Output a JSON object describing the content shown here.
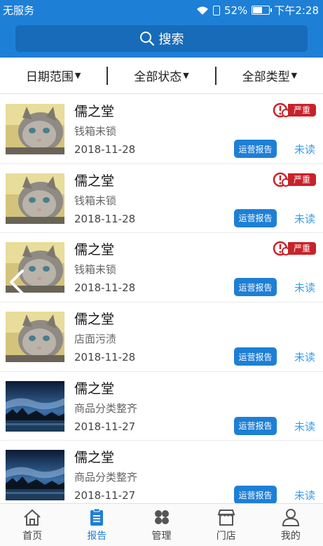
{
  "status_bar": {
    "carrier": "无服务",
    "battery": "52%",
    "time": "下午2:28"
  },
  "search": {
    "label": "搜索"
  },
  "filters": [
    {
      "label": "日期范围"
    },
    {
      "label": "全部状态"
    },
    {
      "label": "全部类型"
    }
  ],
  "list": {
    "items": [
      {
        "title": "儒之堂",
        "desc": "钱箱未锁",
        "date": "2018-11-28",
        "severity": "严重",
        "button": "运营报告",
        "status": "未读",
        "image": "cat"
      },
      {
        "title": "儒之堂",
        "desc": "钱箱未锁",
        "date": "2018-11-28",
        "severity": "严重",
        "button": "运营报告",
        "status": "未读",
        "image": "cat"
      },
      {
        "title": "儒之堂",
        "desc": "钱箱未锁",
        "date": "2018-11-28",
        "severity": "严重",
        "button": "运营报告",
        "status": "未读",
        "image": "cat"
      },
      {
        "title": "儒之堂",
        "desc": "店面污渍",
        "date": "2018-11-28",
        "severity": "",
        "button": "运营报告",
        "status": "未读",
        "image": "cat"
      },
      {
        "title": "儒之堂",
        "desc": "商品分类整齐",
        "date": "2018-11-27",
        "severity": "",
        "button": "运营报告",
        "status": "未读",
        "image": "night"
      },
      {
        "title": "儒之堂",
        "desc": "商品分类整齐",
        "date": "2018-11-27",
        "severity": "",
        "button": "运营报告",
        "status": "未读",
        "image": "night"
      }
    ]
  },
  "tabs": [
    {
      "label": "首页",
      "icon": "home-icon"
    },
    {
      "label": "报告",
      "icon": "clipboard-icon",
      "active": true
    },
    {
      "label": "管理",
      "icon": "grid-icon"
    },
    {
      "label": "门店",
      "icon": "store-icon"
    },
    {
      "label": "我的",
      "icon": "user-icon"
    }
  ],
  "colors": {
    "primary": "#1e7fd6",
    "severity": "#c8222a",
    "unread": "#3a9ce8"
  }
}
